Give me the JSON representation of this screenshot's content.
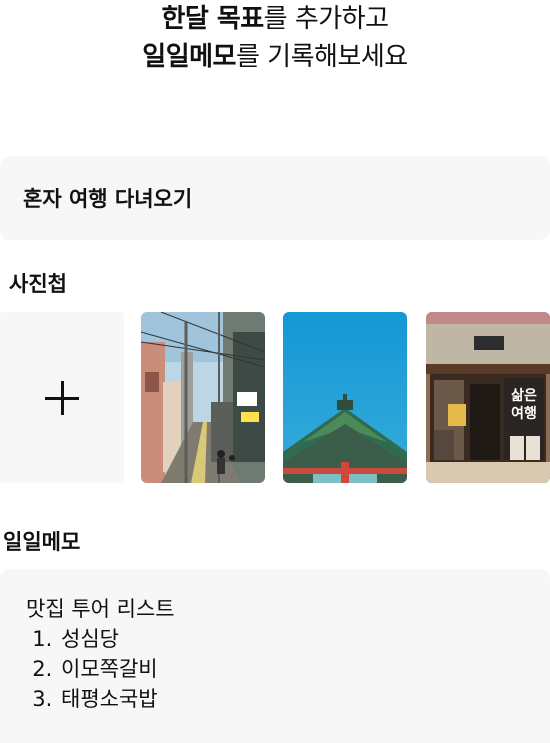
{
  "header": {
    "line1_bold": "한달 목표",
    "line1_rest": "를 추가하고",
    "line2_bold": "일일메모",
    "line2_rest": "를 기록해보세요"
  },
  "goal": {
    "title": "혼자 여행 다녀오기"
  },
  "album": {
    "title": "사진첩",
    "add_icon": "plus-icon",
    "photos": [
      {
        "name": "street-with-power-lines"
      },
      {
        "name": "traditional-korean-roof"
      },
      {
        "name": "bookstore-facade",
        "sign_text": "삶은\n여행"
      }
    ]
  },
  "memo": {
    "title": "일일메모",
    "heading": "맛집 투어 리스트",
    "items": [
      "성심당",
      "이모쪽갈비",
      "태평소국밥"
    ]
  },
  "colors": {
    "card_bg": "#f7f7f7",
    "text": "#111111"
  }
}
